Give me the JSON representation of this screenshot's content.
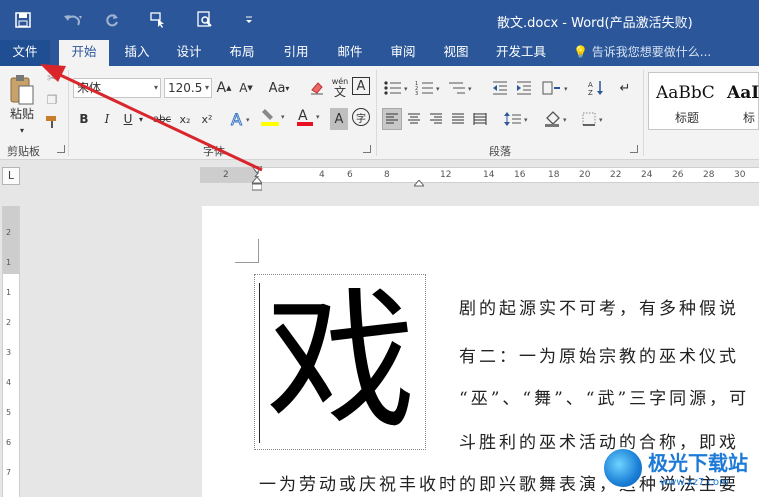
{
  "window": {
    "title": "散文.docx - Word(产品激活失败)"
  },
  "quick_access": [
    {
      "name": "save-icon",
      "glyph": "💾"
    },
    {
      "name": "undo-icon",
      "glyph": "↶"
    },
    {
      "name": "redo-icon",
      "glyph": "↻"
    },
    {
      "name": "touch-mode-icon",
      "glyph": "☝"
    },
    {
      "name": "print-preview-icon",
      "glyph": "🔍"
    },
    {
      "name": "customize-icon",
      "glyph": "▾"
    }
  ],
  "tabs": [
    "文件",
    "开始",
    "插入",
    "设计",
    "布局",
    "引用",
    "邮件",
    "审阅",
    "视图",
    "开发工具"
  ],
  "active_tab": "开始",
  "tell_me": "告诉我您想要做什么...",
  "ribbon": {
    "clipboard": {
      "label": "剪贴板",
      "paste": "粘贴"
    },
    "font": {
      "label": "字体",
      "font_name": "宋体",
      "font_size": "120.5",
      "bold": "B",
      "italic": "I",
      "underline": "U",
      "strike": "abc",
      "subscript": "x₂",
      "superscript": "x²",
      "grow": "A",
      "shrink": "A",
      "case": "Aa",
      "phonetic": "wén",
      "phonetic_sub": "文",
      "char_border": "A",
      "char_shading": "A",
      "enclose": "字",
      "font_color_accent": "#e81123",
      "highlight_accent": "#ffff00"
    },
    "paragraph": {
      "label": "段落"
    },
    "styles": [
      {
        "sample": "AaBbC",
        "name": "标题"
      },
      {
        "sample": "AaI",
        "name": "标"
      }
    ]
  },
  "ruler": {
    "corner": "L",
    "ticks": [
      "2",
      "2",
      "4",
      "6",
      "8",
      "12",
      "14",
      "16",
      "18",
      "20",
      "22",
      "24",
      "26",
      "28",
      "30"
    ],
    "vticks": [
      "2",
      "1",
      "1",
      "2",
      "3",
      "4",
      "5",
      "6",
      "7",
      "8"
    ]
  },
  "document": {
    "dropcap": "戏",
    "lines": [
      "剧的起源实不可考，有多种假说",
      "有二：一为原始宗教的巫术仪式",
      "“巫”、“舞”、“武”三字同源，可",
      "斗胜利的巫术活动的合称，即戏",
      "一为劳动或庆祝丰收时的即兴歌舞表演，这种说法主要"
    ]
  },
  "watermark": {
    "title": "极光下载站",
    "sub": "www.xz7.com"
  },
  "annotation": {
    "arrow_color": "#d9262c"
  }
}
